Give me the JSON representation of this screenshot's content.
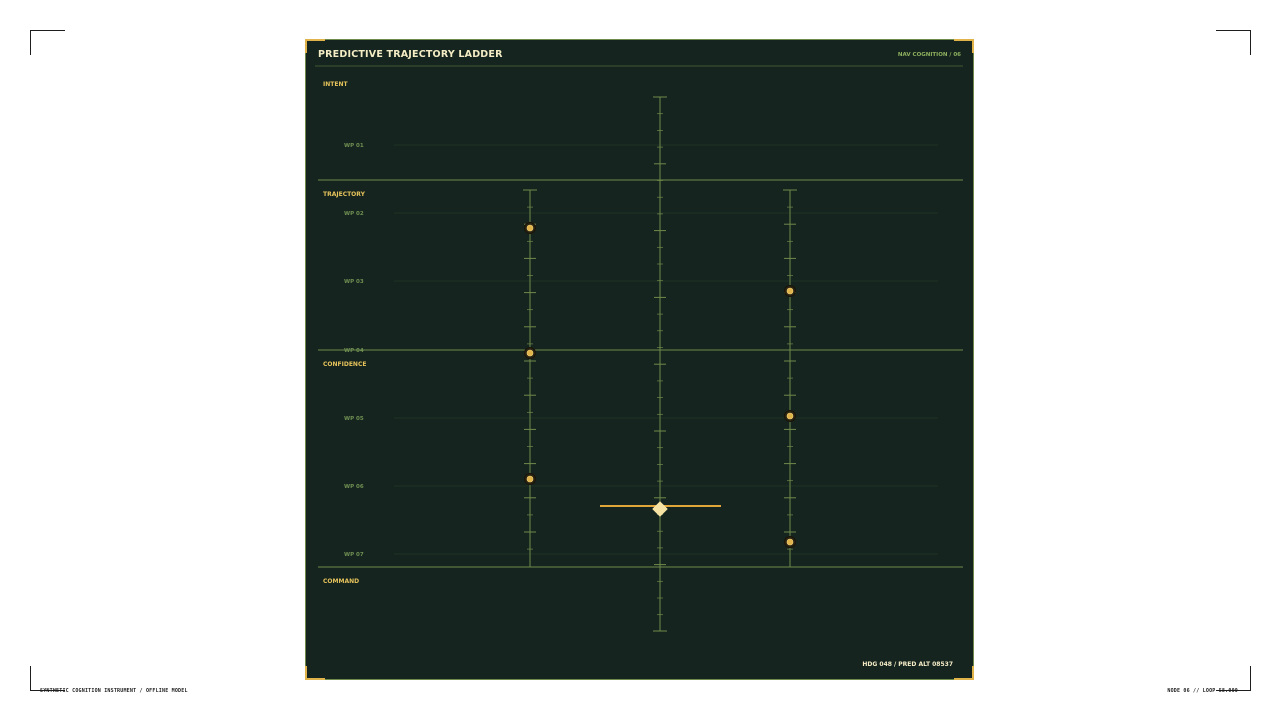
{
  "header": {
    "title": "PREDICTIVE TRAJECTORY LADDER",
    "subtitle": "NAV COGNITION / 06"
  },
  "sections": [
    {
      "label": "INTENT"
    },
    {
      "label": "TRAJECTORY"
    },
    {
      "label": "CONFIDENCE"
    },
    {
      "label": "COMMAND"
    }
  ],
  "waypoints": [
    "WP 01",
    "WP 02",
    "WP 03",
    "WP 04",
    "WP 05",
    "WP 06",
    "WP 07"
  ],
  "status": {
    "readout": "HDG 048 / PRED ALT 08537"
  },
  "footer": {
    "left": "SYNTHETIC COGNITION INSTRUMENT / OFFLINE MODEL",
    "right": "NODE 06 // LOOP 58.000"
  },
  "colors": {
    "panel": "#15241e",
    "line": "#6f8a4a",
    "accent": "#e0b44a",
    "marker": "#f6e3a4",
    "text": "#f3ecc4",
    "label": "#8eb05f"
  }
}
